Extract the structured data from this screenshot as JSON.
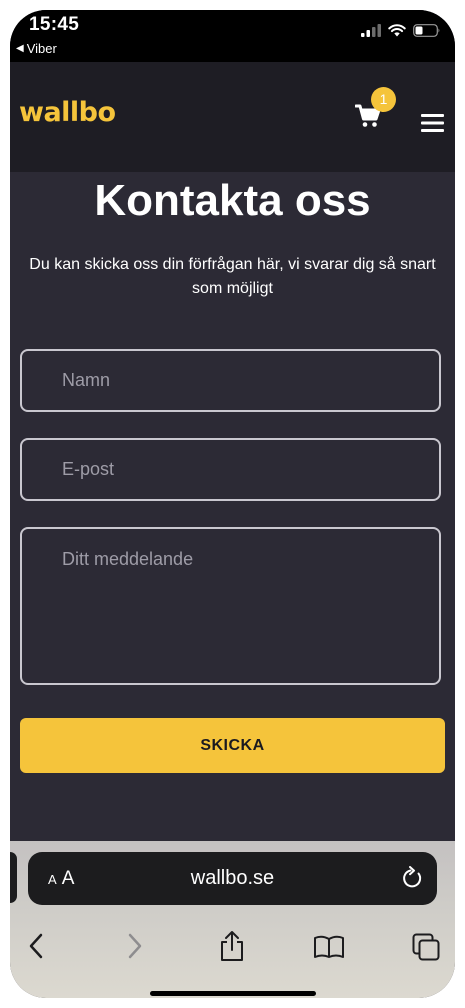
{
  "status_bar": {
    "time": "15:45",
    "back_label": "Viber",
    "icons": [
      "cellular-signal-icon",
      "wifi-icon",
      "battery-icon"
    ]
  },
  "header": {
    "logo_text": "wallbo",
    "cart_count": "1",
    "icons": [
      "cart-icon",
      "hamburger-menu-icon"
    ]
  },
  "page": {
    "title": "Kontakta oss",
    "subtitle": "Du kan skicka oss din förfrågan här, vi svarar dig så snart som möjligt"
  },
  "form": {
    "name_placeholder": "Namn",
    "name_value": "",
    "email_placeholder": "E-post",
    "email_value": "",
    "message_placeholder": "Ditt meddelande",
    "message_value": "",
    "submit_label": "SKICKA"
  },
  "browser": {
    "aa_label": "AA",
    "url": "wallbo.se",
    "icons": [
      "reload-icon",
      "back-arrow-icon",
      "forward-arrow-icon",
      "share-icon",
      "bookmarks-icon",
      "tabs-icon"
    ]
  },
  "colors": {
    "accent": "#f5c43b",
    "page_background": "#2c2a35",
    "header_background": "#1e1d24"
  }
}
